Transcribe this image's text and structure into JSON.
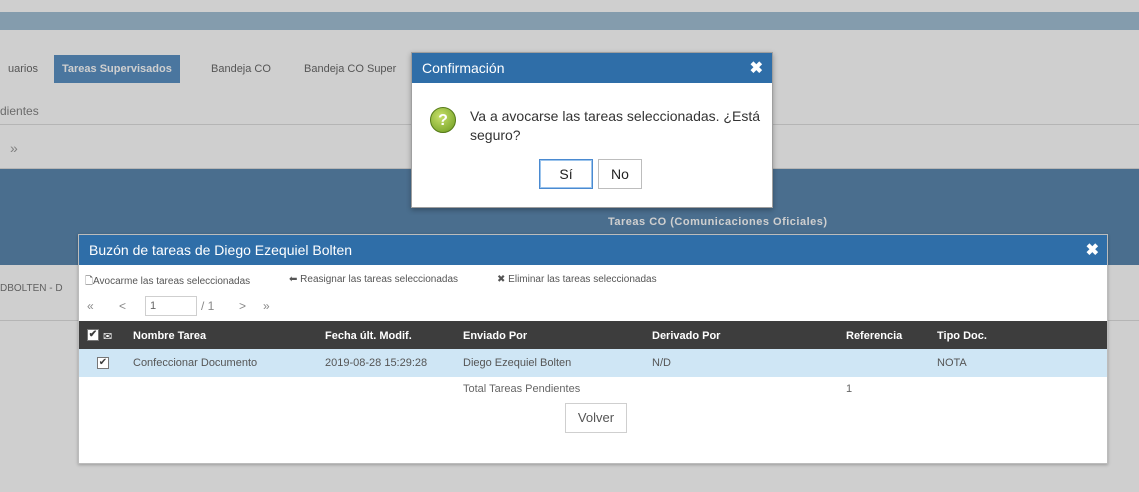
{
  "background": {
    "tabs": [
      {
        "label": "uarios",
        "active": false
      },
      {
        "label": "Tareas Supervisados",
        "active": true
      },
      {
        "label": "Bandeja CO",
        "active": false
      },
      {
        "label": "Bandeja CO Super",
        "active": false
      }
    ],
    "subtitle": "dientes",
    "chevron": "»",
    "band_title": "Tareas CO (Comunicaciones Oficiales)",
    "left_cut_text": "DBOLTEN - D"
  },
  "buzon": {
    "title": "Buzón de tareas de Diego Ezequiel Bolten",
    "close": "✖",
    "actions": [
      {
        "icon": "document-icon",
        "glyph": "🗋",
        "label": "Avocarme las tareas seleccionadas"
      },
      {
        "icon": "reply-icon",
        "glyph": "⬅",
        "label": "Reasignar las tareas seleccionadas"
      },
      {
        "icon": "x-icon",
        "glyph": "✖",
        "label": "Eliminar las tareas seleccionadas"
      }
    ],
    "pager": {
      "first": "«",
      "prev": "<",
      "page": "1",
      "total": "/ 1",
      "next": ">",
      "last": "»"
    },
    "columns": [
      "Nombre Tarea",
      "Fecha últ. Modif.",
      "Enviado Por",
      "Derivado Por",
      "Referencia",
      "Tipo Doc."
    ],
    "rows": [
      {
        "checked": true,
        "nombre": "Confeccionar Documento",
        "fecha": "2019-08-28 15:29:28",
        "enviado": "Diego Ezequiel Bolten",
        "derivado": "N/D",
        "referencia": "",
        "tipo": "NOTA"
      }
    ],
    "total_label": "Total Tareas Pendientes",
    "total_value": "1",
    "volver": "Volver"
  },
  "confirm": {
    "title": "Confirmación",
    "close": "✖",
    "message": "Va a avocarse las tareas seleccionadas. ¿Está seguro?",
    "yes": "Sí",
    "no": "No"
  },
  "colors": {
    "header_blue": "#2f6ea8",
    "band_blue": "#3a6f9f",
    "selected_row": "#cfe6f5",
    "table_header": "#3d3d3d"
  }
}
